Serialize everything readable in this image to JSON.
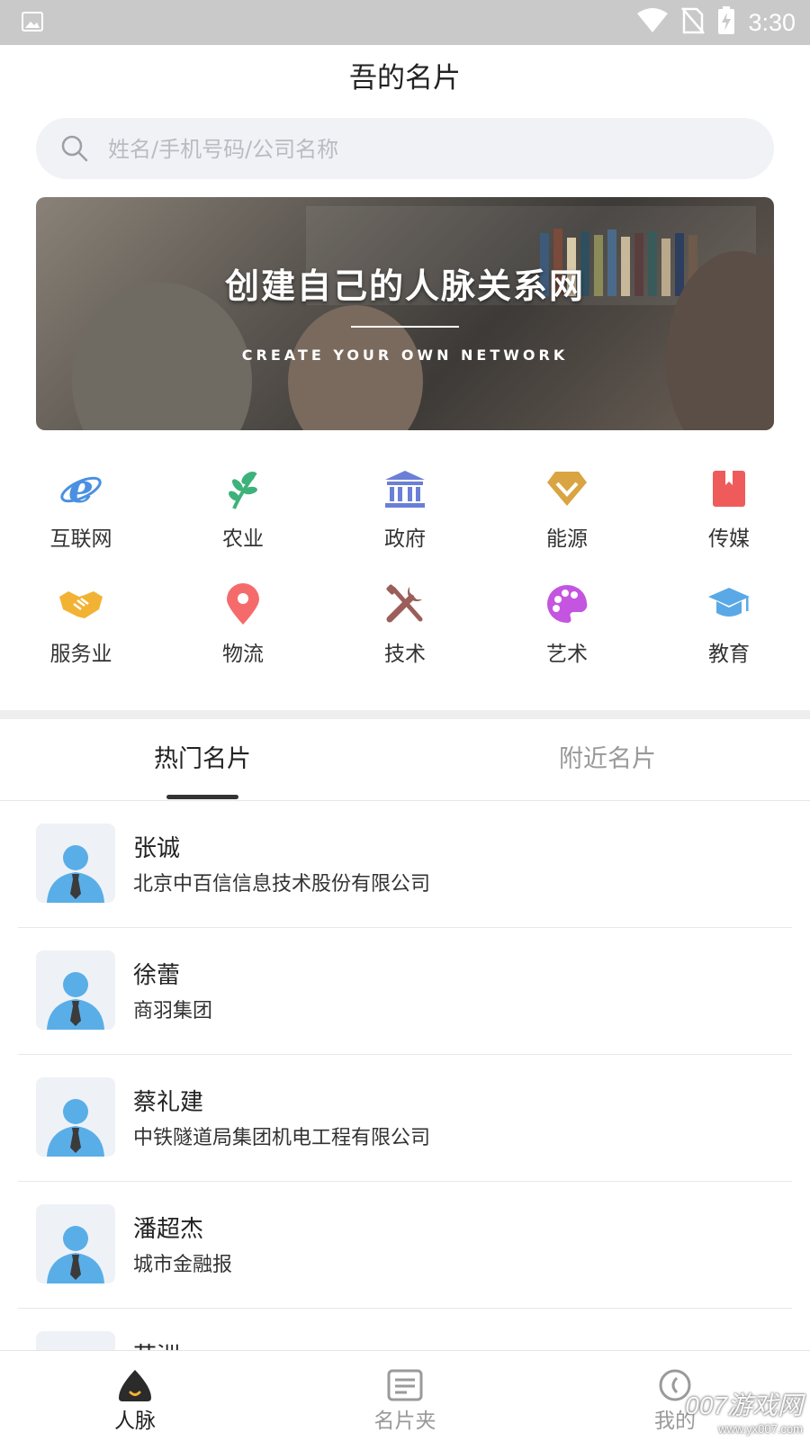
{
  "status_bar": {
    "time": "3:30"
  },
  "header": {
    "title": "吾的名片"
  },
  "search": {
    "placeholder": "姓名/手机号码/公司名称"
  },
  "banner": {
    "heading": "创建自己的人脉关系网",
    "subheading": "CREATE YOUR OWN NETWORK"
  },
  "categories": [
    {
      "label": "互联网",
      "icon": "internet-explorer-icon",
      "color": "#4a90e2"
    },
    {
      "label": "农业",
      "icon": "leaf-icon",
      "color": "#3db27a"
    },
    {
      "label": "政府",
      "icon": "government-building-icon",
      "color": "#6b7fd7"
    },
    {
      "label": "能源",
      "icon": "diamond-icon",
      "color": "#d9a441"
    },
    {
      "label": "传媒",
      "icon": "book-icon",
      "color": "#ef5b5b"
    },
    {
      "label": "服务业",
      "icon": "handshake-icon",
      "color": "#f2b233"
    },
    {
      "label": "物流",
      "icon": "location-pin-icon",
      "color": "#f56b6b"
    },
    {
      "label": "技术",
      "icon": "tools-icon",
      "color": "#9b5e5a"
    },
    {
      "label": "艺术",
      "icon": "palette-icon",
      "color": "#c455e0"
    },
    {
      "label": "教育",
      "icon": "graduation-cap-icon",
      "color": "#5aa9e6"
    }
  ],
  "tabs": [
    {
      "label": "热门名片",
      "active": true
    },
    {
      "label": "附近名片",
      "active": false
    }
  ],
  "contacts": [
    {
      "name": "张诚",
      "company": "北京中百信信息技术股份有限公司"
    },
    {
      "name": "徐蕾",
      "company": "商羽集团"
    },
    {
      "name": "蔡礼建",
      "company": "中铁隧道局集团机电工程有限公司"
    },
    {
      "name": "潘超杰",
      "company": "城市金融报"
    },
    {
      "name": "苏洲",
      "company": ""
    }
  ],
  "bottom_nav": [
    {
      "label": "人脉",
      "icon": "network-icon",
      "active": true
    },
    {
      "label": "名片夹",
      "icon": "card-holder-icon",
      "active": false
    },
    {
      "label": "我的",
      "icon": "profile-icon",
      "active": false
    }
  ],
  "watermark": {
    "line1": "007游戏网",
    "line2": "www.yx007.com"
  }
}
